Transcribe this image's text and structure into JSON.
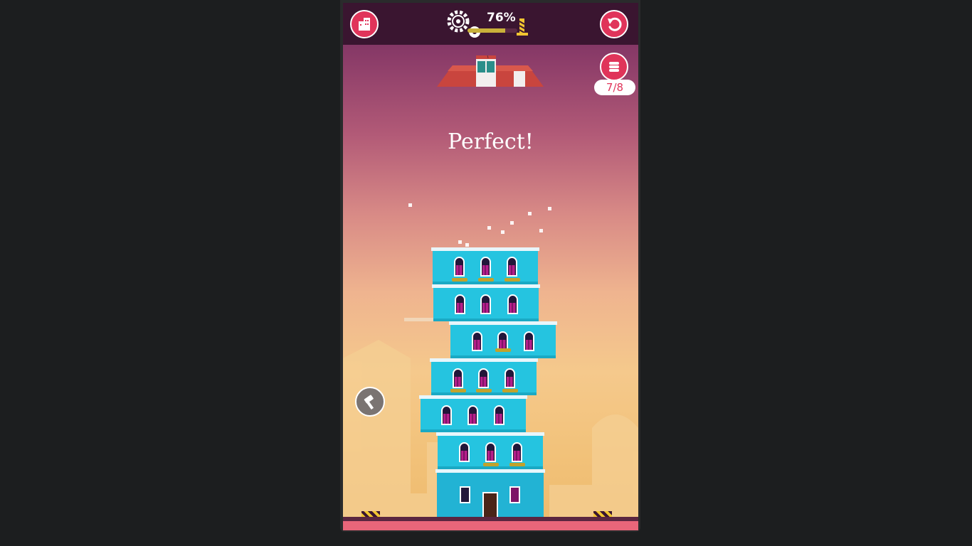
{
  "hud": {
    "progress_text": "76%",
    "progress_value": 0.76,
    "floors_counter": "7/8"
  },
  "message": "Perfect!",
  "colors": {
    "accent": "#e0345a",
    "building": "#25c4e0",
    "topbar": "#3a1530"
  },
  "icons": {
    "city": "city-buildings-icon",
    "restart": "restart-arrow-icon",
    "settings": "gears-icon",
    "crane": "crane-icon",
    "floors": "stacked-floors-icon",
    "hammer": "hammer-icon"
  }
}
